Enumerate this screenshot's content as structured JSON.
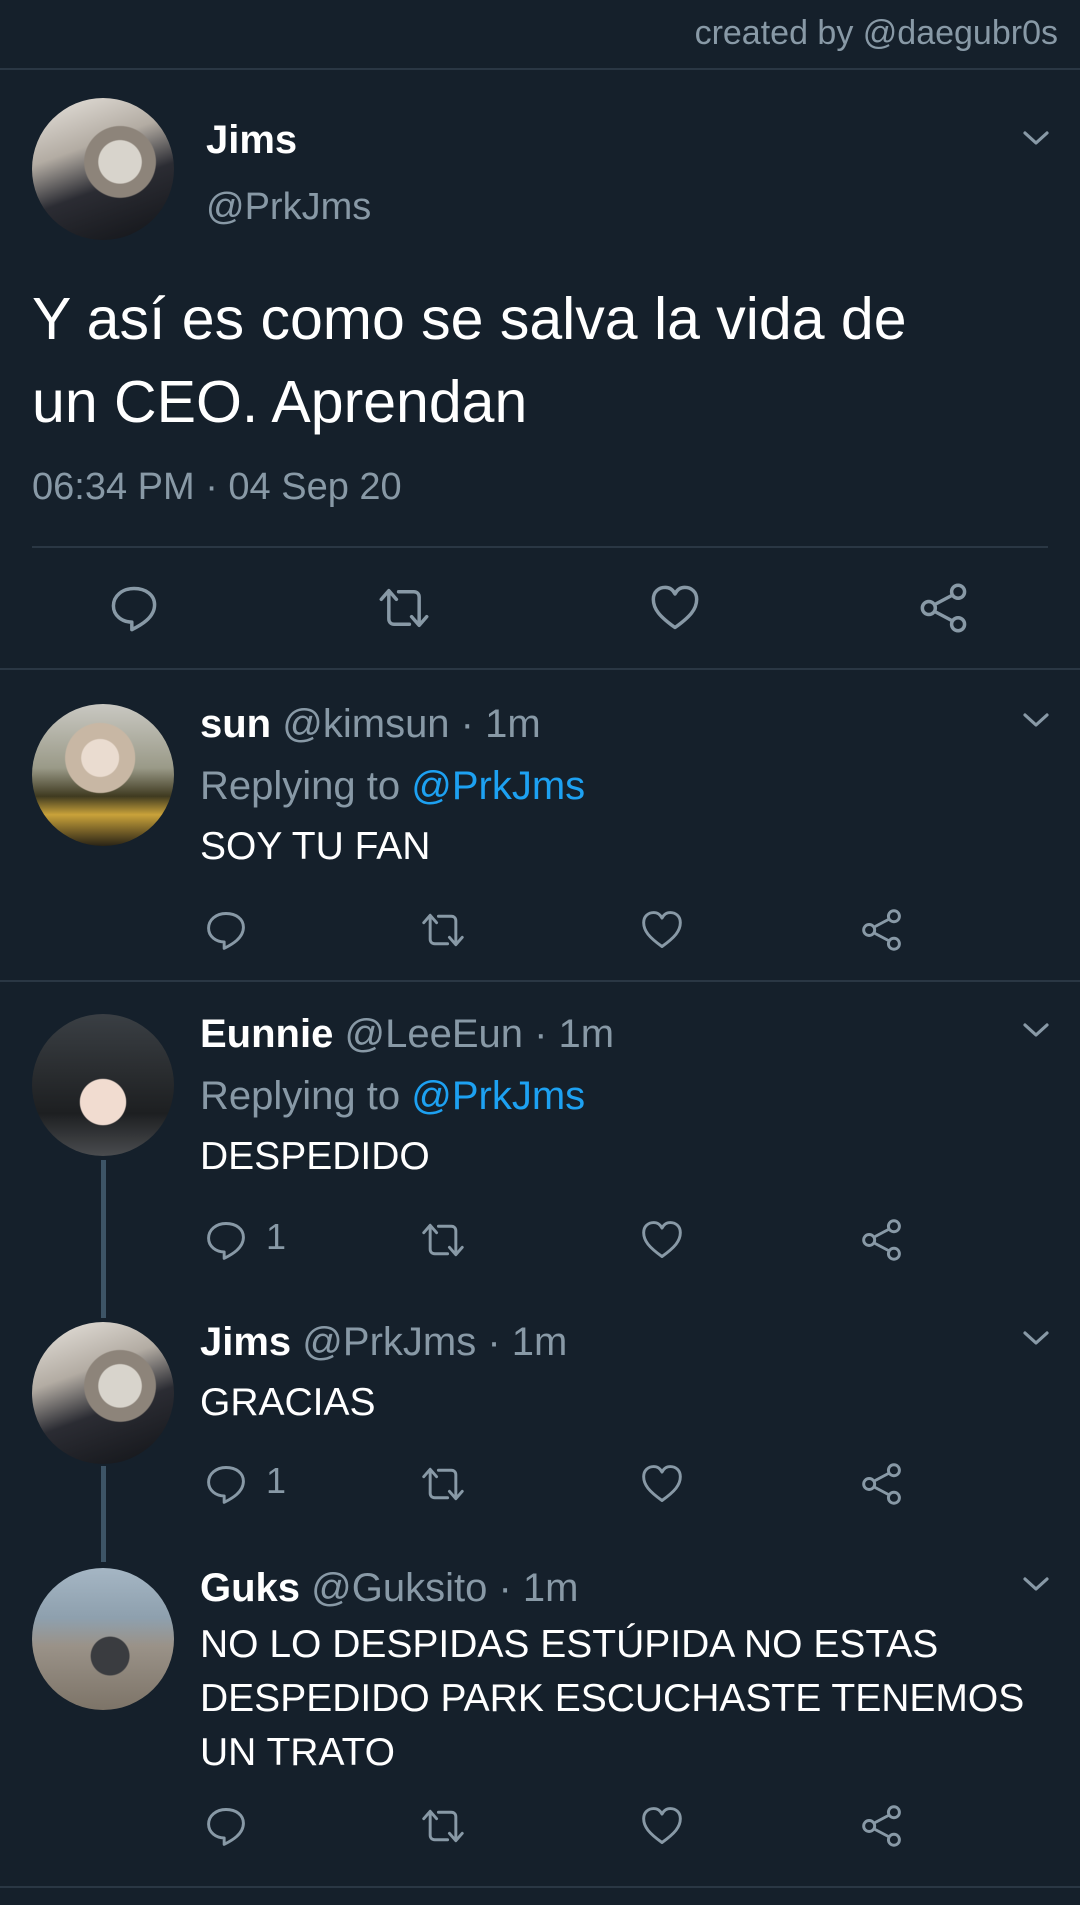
{
  "credit": "created by @daegubr0s",
  "main_tweet": {
    "name": "Jims",
    "handle": "@PrkJms",
    "text_line1": "Y así es como se salva la vida de",
    "text_line2": "un CEO.  Aprendan",
    "timestamp": "06:34 PM · 04 Sep 20"
  },
  "replies": [
    {
      "name": "sun",
      "meta": "@kimsun · 1m",
      "replying_prefix": "Replying to ",
      "replying_to": "@PrkJms",
      "text": "SOY TU FAN",
      "reply_count": ""
    },
    {
      "name": "Eunnie",
      "meta": "@LeeEun · 1m",
      "replying_prefix": "Replying to ",
      "replying_to": "@PrkJms",
      "text": "DESPEDIDO",
      "reply_count": "1"
    },
    {
      "name": "Jims",
      "meta": "@PrkJms · 1m",
      "text": "GRACIAS",
      "reply_count": "1"
    },
    {
      "name": "Guks",
      "meta": "@Guksito · 1m",
      "text_line1": "NO LO DESPIDAS ESTÚPIDA NO ESTAS",
      "text_line2": "DESPEDIDO PARK ESCUCHASTE TENEMOS",
      "text_line3": "UN TRATO",
      "reply_count": ""
    }
  ],
  "icons": {
    "reply": "reply-icon",
    "retweet": "retweet-icon",
    "like": "heart-icon",
    "share": "share-icon",
    "more": "chevron-down-icon"
  },
  "colors": {
    "background": "#15202b",
    "secondary_text": "#8899a6",
    "link": "#1da1f2",
    "divider": "#2a3744"
  }
}
